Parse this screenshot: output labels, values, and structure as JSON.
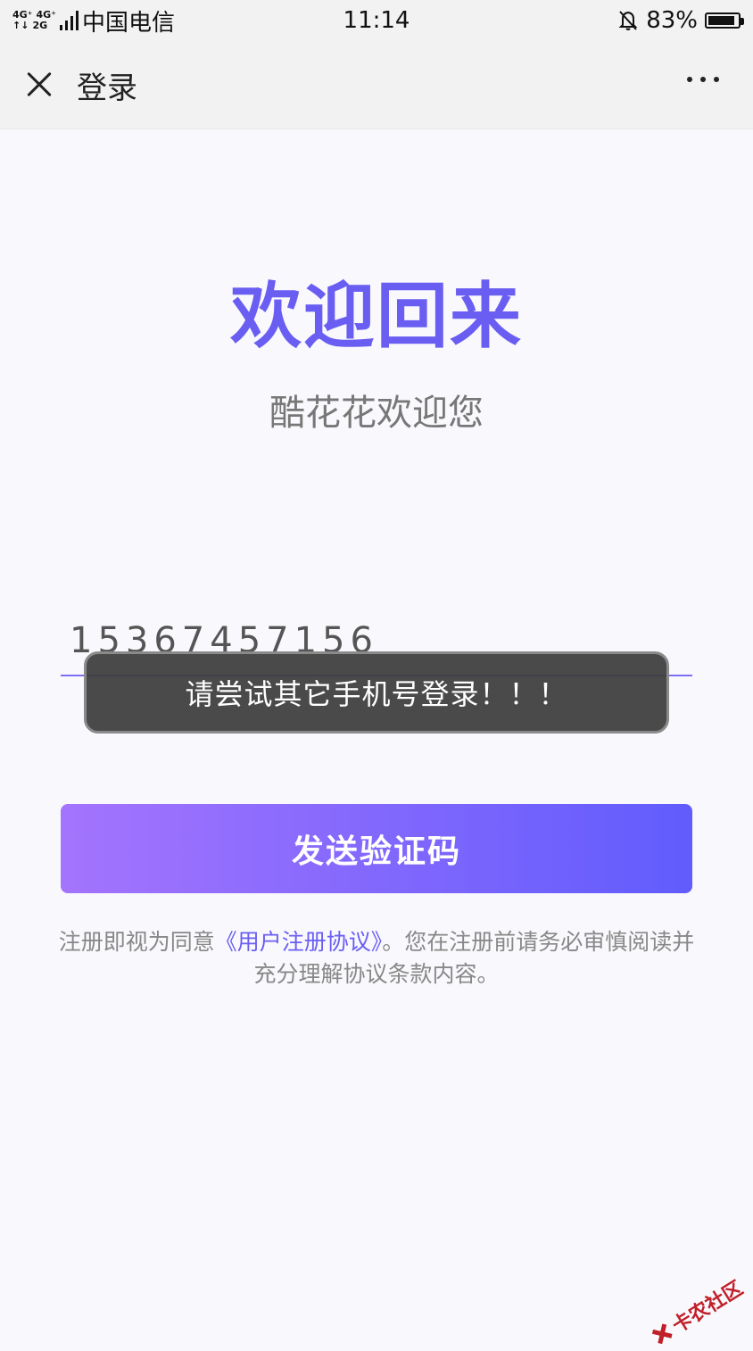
{
  "status_bar": {
    "network_top": [
      "4G⁺",
      "4G⁺"
    ],
    "network_bottom": [
      "↑↓",
      "2G"
    ],
    "carrier": "中国电信",
    "time": "11:14",
    "battery_percent": "83%",
    "battery_level": 0.83
  },
  "nav": {
    "title": "登录",
    "close_icon": "close-icon",
    "more_icon": "more-dots-icon"
  },
  "welcome": {
    "title": "欢迎回来",
    "subtitle": "酷花花欢迎您"
  },
  "phone_field": {
    "value": "15367457156"
  },
  "toast": {
    "message": "请尝试其它手机号登录！！！"
  },
  "send_button": {
    "label": "发送验证码"
  },
  "agreement": {
    "prefix": "注册即视为同意",
    "link": "《用户注册协议》",
    "suffix": "。您在注册前请务必审慎阅读并充分理解协议条款内容。"
  },
  "watermark": {
    "text": "卡农社区"
  },
  "colors": {
    "accent": "#6a5ef2",
    "button_gradient_start": "#a474fd",
    "button_gradient_end": "#615cfd",
    "toast_bg": "#3c3c3c"
  }
}
